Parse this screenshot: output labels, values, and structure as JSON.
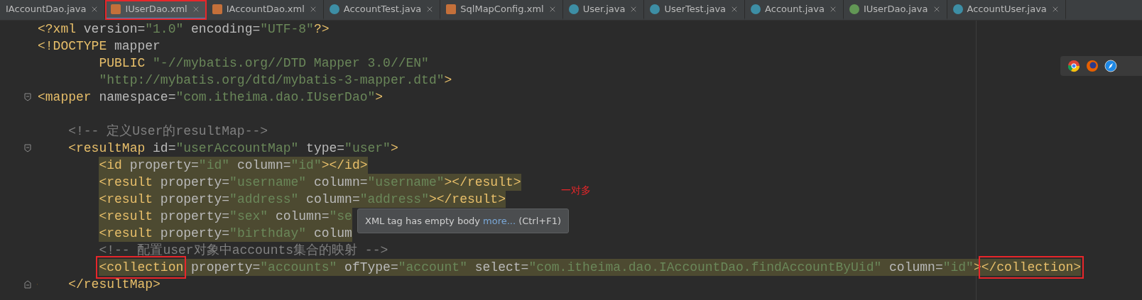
{
  "tabs": [
    {
      "label": "IAccountDao.java",
      "kind": "none",
      "selected": false,
      "boxed": false
    },
    {
      "label": "IUserDao.xml",
      "kind": "xml",
      "selected": true,
      "boxed": true
    },
    {
      "label": "IAccountDao.xml",
      "kind": "xml",
      "selected": false,
      "boxed": false
    },
    {
      "label": "AccountTest.java",
      "kind": "test",
      "selected": false,
      "boxed": false
    },
    {
      "label": "SqlMapConfig.xml",
      "kind": "xml",
      "selected": false,
      "boxed": false
    },
    {
      "label": "User.java",
      "kind": "class",
      "selected": false,
      "boxed": false
    },
    {
      "label": "UserTest.java",
      "kind": "test",
      "selected": false,
      "boxed": false
    },
    {
      "label": "Account.java",
      "kind": "class",
      "selected": false,
      "boxed": false
    },
    {
      "label": "IUserDao.java",
      "kind": "interface",
      "selected": false,
      "boxed": false
    },
    {
      "label": "AccountUser.java",
      "kind": "class",
      "selected": false,
      "boxed": false
    }
  ],
  "editor": {
    "lines": [
      {
        "highlighted": false,
        "tokens": [
          {
            "kind": "tag",
            "s": "<?xml"
          },
          {
            "kind": "attr",
            "s": " version="
          },
          {
            "kind": "value",
            "s": "\"1.0\""
          },
          {
            "kind": "attr",
            "s": " encoding="
          },
          {
            "kind": "value",
            "s": "\"UTF-8\""
          },
          {
            "kind": "tag",
            "s": "?>"
          }
        ]
      },
      {
        "highlighted": false,
        "tokens": [
          {
            "kind": "tag",
            "s": "<!DOCTYPE"
          },
          {
            "kind": "attr",
            "s": " mapper"
          }
        ]
      },
      {
        "highlighted": false,
        "tokens": [
          {
            "kind": "tag",
            "s": "        PUBLIC"
          },
          {
            "kind": "value",
            "s": " \"-//mybatis.org//DTD Mapper 3.0//EN\""
          }
        ]
      },
      {
        "highlighted": false,
        "tokens": [
          {
            "kind": "value",
            "s": "        \"http://mybatis.org/dtd/mybatis-3-mapper.dtd\""
          },
          {
            "kind": "tag",
            "s": ">"
          }
        ]
      },
      {
        "highlighted": false,
        "gutter": [
          {
            "kind": "fold"
          }
        ],
        "tokens": [
          {
            "kind": "tag",
            "s": "<mapper"
          },
          {
            "kind": "attr",
            "s": " namespace="
          },
          {
            "kind": "value",
            "s": "\"com.itheima.dao.IUserDao\""
          },
          {
            "kind": "tag",
            "s": ">"
          }
        ]
      },
      {
        "highlighted": false
      },
      {
        "highlighted": false,
        "tokens": [
          {
            "kind": "comment",
            "s": "    <!-- 定义User的resultMap-->"
          }
        ]
      },
      {
        "highlighted": false,
        "gutter": [
          {
            "kind": "fold"
          }
        ],
        "tokens": [
          {
            "kind": "tag",
            "s": "    <resultMap"
          },
          {
            "kind": "attr",
            "s": " id="
          },
          {
            "kind": "value",
            "s": "\"userAccountMap\""
          },
          {
            "kind": "attr",
            "s": " type="
          },
          {
            "kind": "value",
            "s": "\"user\""
          },
          {
            "kind": "tag",
            "s": ">"
          }
        ]
      },
      {
        "highlighted": true,
        "tokens": [
          {
            "kind": "tag",
            "s": "        <id"
          },
          {
            "kind": "attr",
            "s": " property="
          },
          {
            "kind": "value",
            "s": "\"id\""
          },
          {
            "kind": "attr",
            "s": " column="
          },
          {
            "kind": "value",
            "s": "\"id\""
          },
          {
            "kind": "tag",
            "s": "></id>"
          }
        ]
      },
      {
        "highlighted": true,
        "tokens": [
          {
            "kind": "tag",
            "s": "        <result"
          },
          {
            "kind": "attr",
            "s": " property="
          },
          {
            "kind": "value",
            "s": "\"username\""
          },
          {
            "kind": "attr",
            "s": " column="
          },
          {
            "kind": "value",
            "s": "\"username\""
          },
          {
            "kind": "tag",
            "s": "></result>"
          }
        ]
      },
      {
        "highlighted": true,
        "tokens": [
          {
            "kind": "tag",
            "s": "        <result"
          },
          {
            "kind": "attr",
            "s": " property="
          },
          {
            "kind": "value",
            "s": "\"address\""
          },
          {
            "kind": "attr",
            "s": " column="
          },
          {
            "kind": "value",
            "s": "\"address\""
          },
          {
            "kind": "tag",
            "s": "></result>"
          }
        ]
      },
      {
        "highlighted": true,
        "tokens": [
          {
            "kind": "tag",
            "s": "        <result"
          },
          {
            "kind": "attr",
            "s": " property="
          },
          {
            "kind": "value",
            "s": "\"sex\""
          },
          {
            "kind": "attr",
            "s": " column="
          },
          {
            "kind": "value",
            "s": "\"se"
          }
        ]
      },
      {
        "highlighted": true,
        "tokens": [
          {
            "kind": "tag",
            "s": "        <result"
          },
          {
            "kind": "attr",
            "s": " property="
          },
          {
            "kind": "value",
            "s": "\"birthday\""
          },
          {
            "kind": "attr",
            "s": " colum"
          }
        ]
      },
      {
        "highlighted": false,
        "tokens": [
          {
            "kind": "comment",
            "s": "        <!-- 配置user对象中accounts集合的映射 -->"
          }
        ]
      },
      {
        "highlighted": true,
        "tokens": [
          {
            "kind": "tag",
            "s": "        <collection",
            "boxed": true
          },
          {
            "kind": "attr",
            "s": " property="
          },
          {
            "kind": "value",
            "s": "\"accounts\""
          },
          {
            "kind": "attr",
            "s": " ofType="
          },
          {
            "kind": "value",
            "s": "\"account\""
          },
          {
            "kind": "attr",
            "s": " select="
          },
          {
            "kind": "value",
            "s": "\"com.itheima.dao.IAccountDao.findAccountByUid\""
          },
          {
            "kind": "attr",
            "s": " column="
          },
          {
            "kind": "value",
            "s": "\"id\""
          },
          {
            "kind": "tag",
            "s": ">"
          },
          {
            "kind": "tag",
            "s": "</collection>",
            "boxed": true
          }
        ]
      },
      {
        "highlighted": false,
        "gutter": [
          {
            "kind": "fold-end"
          },
          {
            "kind": "bulb"
          }
        ],
        "tokens": [
          {
            "kind": "tag",
            "s": "    </resultMap>"
          }
        ]
      }
    ]
  },
  "tooltip": {
    "message": "XML tag has empty body",
    "link": "more...",
    "shortcut": "(Ctrl+F1)"
  },
  "note": "一对多"
}
